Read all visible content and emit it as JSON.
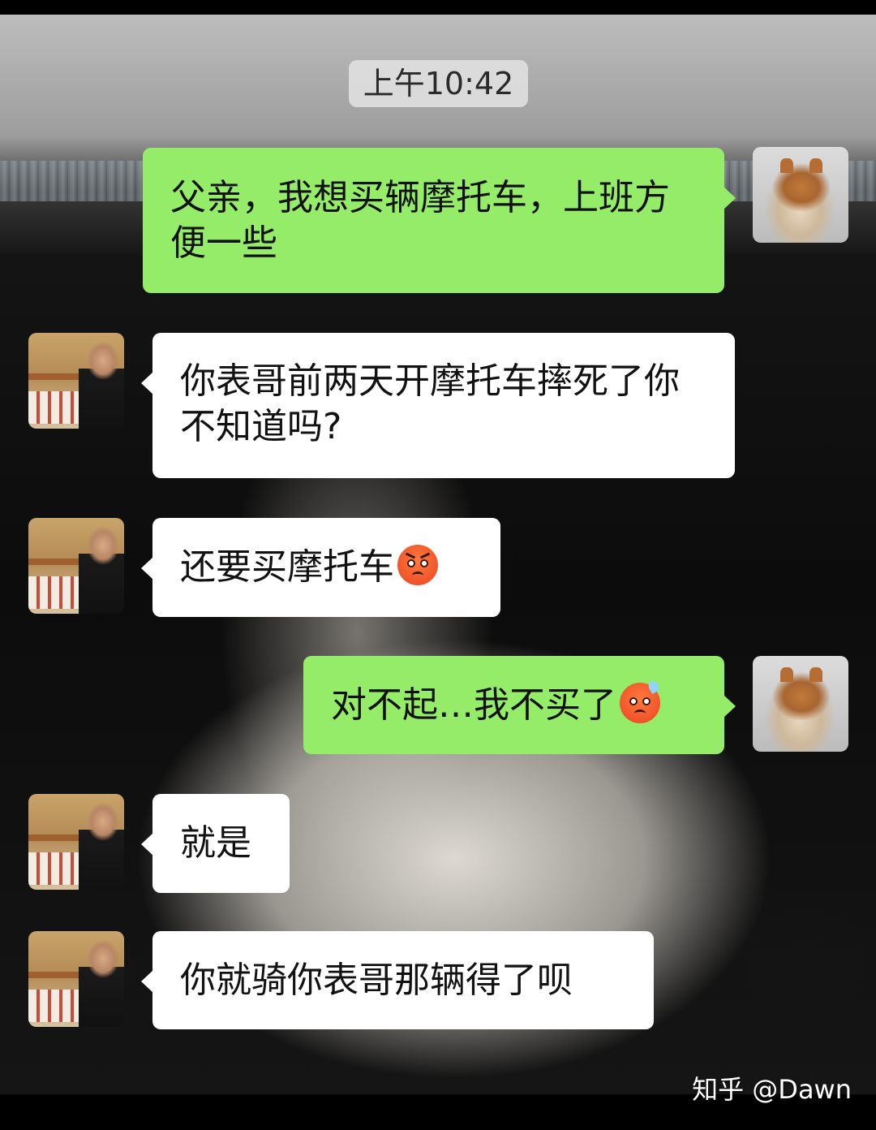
{
  "chat": {
    "timestamp": "上午10:42",
    "messages": [
      {
        "sender": "me",
        "text": "父亲，我想买辆摩托车，上班方便一些"
      },
      {
        "sender": "other",
        "text": "你表哥前两天开摩托车摔死了你不知道吗?"
      },
      {
        "sender": "other",
        "text": "还要买摩托车",
        "emoji": "angry-face-emoji"
      },
      {
        "sender": "me",
        "text": "对不起…我不买了",
        "emoji": "sweat-face-emoji"
      },
      {
        "sender": "other",
        "text": "就是"
      },
      {
        "sender": "other",
        "text": "你就骑你表哥那辆得了呗"
      }
    ]
  },
  "colors": {
    "my_bubble": "#95ec69",
    "other_bubble": "#ffffff",
    "timestamp_bg": "#dedede"
  },
  "watermark": {
    "site": "知乎",
    "user": "@Dawn"
  }
}
